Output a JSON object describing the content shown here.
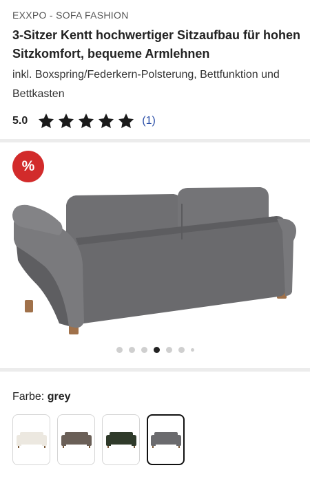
{
  "product": {
    "brand": "EXXPO - SOFA FASHION",
    "title": "3-Sitzer Kentt hochwertiger Sitzaufbau für hohen Sitzkomfort, bequeme Armlehnen",
    "subtitle": "inkl. Boxspring/Federkern-Polsterung, Bettfunktion und Bettkasten"
  },
  "rating": {
    "value": "5.0",
    "stars": 5,
    "count": "(1)",
    "star_color": "#1a1a1a"
  },
  "gallery": {
    "badge": "%",
    "badge_color": "#d22b2b",
    "image": "grey-3-seat-sofa-rear-view",
    "dots_total": 7,
    "active_index": 3
  },
  "color": {
    "label": "Farbe:",
    "selected": "grey",
    "swatches": [
      {
        "name": "cream",
        "color": "#ece8e0",
        "selected": false
      },
      {
        "name": "brown",
        "color": "#6a5f57",
        "selected": false
      },
      {
        "name": "green",
        "color": "#2f3a2a",
        "selected": false
      },
      {
        "name": "grey",
        "color": "#6b6b6e",
        "selected": true
      }
    ]
  }
}
